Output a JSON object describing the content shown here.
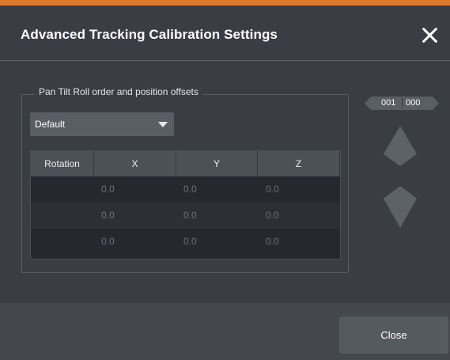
{
  "dialog": {
    "title": "Advanced Tracking Calibration Settings",
    "accent_color": "#e07a2a"
  },
  "group": {
    "legend": "Pan Tilt Roll order and position offsets"
  },
  "dropdown": {
    "selected": "Default"
  },
  "table": {
    "headers": [
      "Rotation",
      "X",
      "Y",
      "Z"
    ],
    "rows": [
      [
        "",
        "0.0",
        "0.0",
        "0.0"
      ],
      [
        "",
        "0.0",
        "0.0",
        "0.0"
      ],
      [
        "",
        "0.0",
        "0.0",
        "0.0"
      ]
    ]
  },
  "pager": {
    "current": "001",
    "total": "000"
  },
  "footer": {
    "close_label": "Close"
  },
  "icons": {
    "close": "close-icon",
    "dropdown": "chevron-down-icon",
    "up": "arrow-up-icon",
    "down": "arrow-down-icon"
  }
}
